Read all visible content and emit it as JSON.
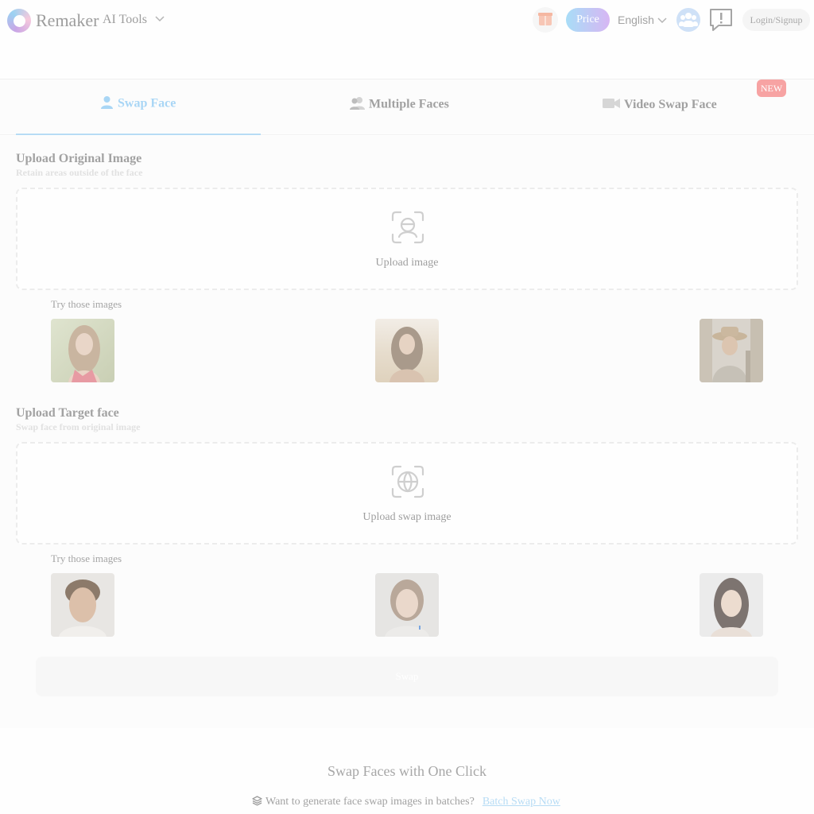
{
  "header": {
    "brand": "Remaker",
    "ai_tools_label": "AI Tools",
    "price_label": "Price",
    "language": "English",
    "login_label": "Login/Signup"
  },
  "tabs": [
    {
      "label": "Swap Face",
      "icon": "person-icon",
      "active": true
    },
    {
      "label": "Multiple Faces",
      "icon": "people-icon",
      "active": false
    },
    {
      "label": "Video Swap Face",
      "icon": "video-icon",
      "active": false,
      "badge": "NEW"
    }
  ],
  "original_section": {
    "title": "Upload Original Image",
    "subtitle": "Retain areas outside of the face",
    "upload_label": "Upload image",
    "try_label": "Try those images"
  },
  "target_section": {
    "title": "Upload Target face",
    "subtitle": "Swap face from original image",
    "upload_label": "Upload swap image",
    "try_label": "Try those images"
  },
  "swap_button": "Swap",
  "bottom": {
    "title": "Swap Faces with One Click",
    "batch_text": "Want to generate face swap images in batches?",
    "batch_link": "Batch Swap Now"
  },
  "colors": {
    "accent": "#a9d6f5",
    "price_gradient_start": "#a8ddf7",
    "price_gradient_end": "#d7b6f3",
    "new_badge": "#f7a3a3"
  }
}
